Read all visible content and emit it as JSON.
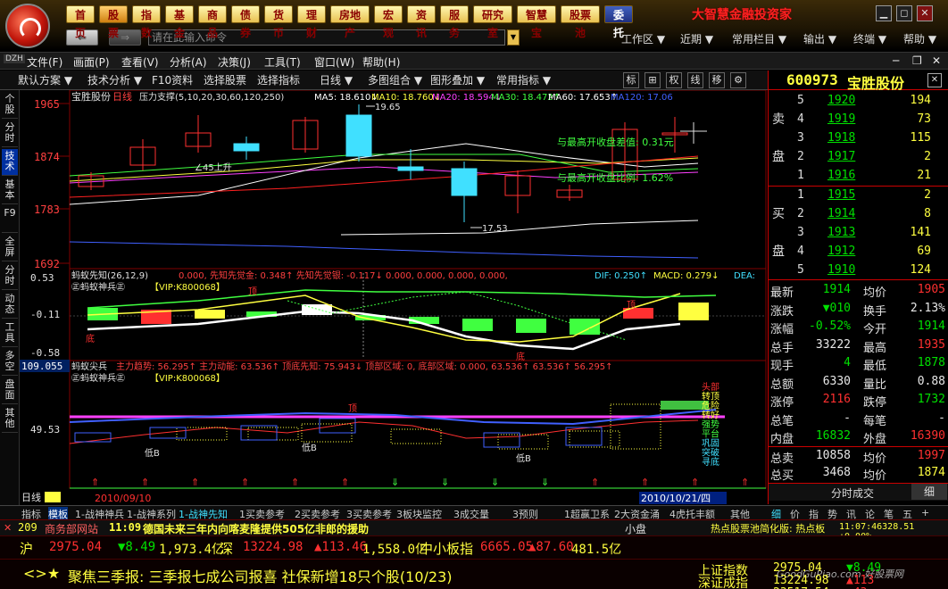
{
  "nav": {
    "items": [
      "首页",
      "股票",
      "指数",
      "基金",
      "商品",
      "债券",
      "货币",
      "理财",
      "房地产",
      "宏观",
      "资讯",
      "服务",
      "研究室",
      "智慧宝",
      "股票池",
      "委托"
    ],
    "selected": "股票",
    "brand": "大智慧金融投资家"
  },
  "command": {
    "placeholder": "请在此输入命令"
  },
  "top_menus": [
    "工作区 ▼",
    "近期 ▼",
    "常用栏目 ▼",
    "输出 ▼",
    "终端 ▼",
    "帮助 ▼"
  ],
  "menubar": [
    "文件(F)",
    "画面(P)",
    "查看(V)",
    "分析(A)",
    "决策(J)",
    "工具(T)",
    "窗口(W)",
    "帮助(H)"
  ],
  "toolbar": {
    "items": [
      "默认方案 ▼",
      "技术分析 ▼",
      "F10资料",
      "选择股票",
      "选择指标",
      "日线 ▼",
      "多图组合 ▼",
      "图形叠加 ▼",
      "常用指标 ▼"
    ],
    "right_buttons": [
      "标",
      "⊞",
      "权",
      "线",
      "移",
      "⚙"
    ]
  },
  "left_tabs": [
    "个股",
    "分时",
    "技术",
    "基本",
    "F9",
    "全屏",
    "分时",
    "动态",
    "工具",
    "多空",
    "盘面",
    "其他"
  ],
  "chart": {
    "main_title": "宝胜股份",
    "period": "日线",
    "indicator": "压力支撑(5,10,20,30,60,120,250)",
    "ma": [
      {
        "label": "MA5: 18.610↓",
        "color": "#ffffff"
      },
      {
        "label": "MA10: 18.760↓",
        "color": "#ffff40"
      },
      {
        "label": "MA20: 18.594↓",
        "color": "#ff40ff"
      },
      {
        "label": "MA30: 18.472↑",
        "color": "#40ff40"
      },
      {
        "label": "MA60: 17.653↑",
        "color": "#ffffff"
      },
      {
        "label": "MA120: 17.06",
        "color": "#4060ff"
      }
    ],
    "y_labels": [
      "1965",
      "1874",
      "1783",
      "1692"
    ],
    "annotations": [
      "19.65",
      "17.53",
      "∠45上升",
      "与最高开收盘差值: 0.31元",
      "与最高开收盘比例: 1.62%"
    ],
    "sub1": {
      "title": "蚂蚁先知(26,12,9)",
      "values": "0.000,  先知先觉金: 0.348↑  先知先觉银: -0.117↓  0.000, 0.000, 0.000, 0.000,",
      "dif": "DIF: 0.250↑",
      "macd": "MACD: 0.279↓",
      "dea": "DEA:",
      "badge": "㊣蚂蚁神兵㊣",
      "vip": "【VIP:K800068】",
      "y_labels": [
        "0.53",
        "-0.11",
        "-0.58"
      ],
      "marks": [
        "顶",
        "底",
        "顶",
        "底"
      ]
    },
    "sub2": {
      "title": "蚂蚁尖兵",
      "items": "主力趋势: 56.295↑  主力动能: 63.536↑  顶底先知: 75.943↓  顶部区域: 0,  底部区域: 0.000, 63.536↑  63.536↑  56.295↑",
      "badge": "㊣蚂蚁神兵㊣",
      "vip": "【VIP:K800068】",
      "y_labels": [
        "109.055",
        "49.53"
      ],
      "marks": [
        "顶",
        "低B",
        "低B",
        "低B",
        "头部",
        "转顶",
        "危险",
        "转好",
        "强势",
        "平台",
        "巩固",
        "突破",
        "寻底"
      ]
    },
    "period_label": "日线",
    "date_left": "2010/09/10",
    "date_right": "2010/10/21/四"
  },
  "quote": {
    "code": "600973",
    "name": "宝胜股份",
    "sell": [
      {
        "lvl": "5",
        "price": "1920",
        "vol": "194"
      },
      {
        "lvl": "4",
        "price": "1919",
        "vol": "73"
      },
      {
        "lvl": "3",
        "price": "1918",
        "vol": "115"
      },
      {
        "lvl": "2",
        "price": "1917",
        "vol": "2"
      },
      {
        "lvl": "1",
        "price": "1916",
        "vol": "21"
      }
    ],
    "buy": [
      {
        "lvl": "1",
        "price": "1915",
        "vol": "2"
      },
      {
        "lvl": "2",
        "price": "1914",
        "vol": "8"
      },
      {
        "lvl": "3",
        "price": "1913",
        "vol": "141"
      },
      {
        "lvl": "4",
        "price": "1912",
        "vol": "69"
      },
      {
        "lvl": "5",
        "price": "1910",
        "vol": "124"
      }
    ],
    "sell_label": [
      "卖",
      "盘"
    ],
    "buy_label": [
      "买",
      "盘"
    ],
    "stats": [
      {
        "l1": "最新",
        "v1": "1914",
        "l2": "均价",
        "v2": "1905",
        "c1": "grn",
        "c2": "red"
      },
      {
        "l1": "涨跌",
        "v1": "▼010",
        "l2": "换手",
        "v2": "2.13%",
        "c1": "grn",
        "c2": "wht"
      },
      {
        "l1": "涨幅",
        "v1": "-0.52%",
        "l2": "今开",
        "v2": "1914",
        "c1": "grn",
        "c2": "grn"
      },
      {
        "l1": "总手",
        "v1": "33222",
        "l2": "最高",
        "v2": "1935",
        "c1": "wht",
        "c2": "red"
      },
      {
        "l1": "现手",
        "v1": "4",
        "l2": "最低",
        "v2": "1878",
        "c1": "grn",
        "c2": "grn"
      },
      {
        "l1": "总额",
        "v1": "6330",
        "l2": "量比",
        "v2": "0.88",
        "c1": "wht",
        "c2": "wht"
      },
      {
        "l1": "涨停",
        "v1": "2116",
        "l2": "跌停",
        "v2": "1732",
        "c1": "red",
        "c2": "grn"
      },
      {
        "l1": "总笔",
        "v1": "-",
        "l2": "每笔",
        "v2": "-",
        "c1": "wht",
        "c2": "wht"
      },
      {
        "l1": "内盘",
        "v1": "16832",
        "l2": "外盘",
        "v2": "16390",
        "c1": "grn",
        "c2": "red"
      },
      {
        "l1": "总卖",
        "v1": "10858",
        "l2": "均价",
        "v2": "1997",
        "c1": "wht",
        "c2": "red"
      },
      {
        "l1": "总买",
        "v1": "3468",
        "l2": "均价",
        "v2": "1874",
        "c1": "wht",
        "c2": "yel"
      }
    ],
    "timeshare_btn": "分时成交",
    "small_btn": "细",
    "bottom_tabs": [
      "细",
      "价",
      "指",
      "势",
      "讯",
      "论",
      "笔",
      "五",
      "+"
    ]
  },
  "bottom_tabs": [
    "指标",
    "模板",
    "1-战神神兵",
    "1-战神系列",
    "1-战神先知",
    "1买卖参考",
    "2买卖参考",
    "3买卖参考",
    "3板块监控",
    "3成交量",
    "3预则",
    "1超赢卫系",
    "2大资金涌",
    "4虎托丰额",
    "其他"
  ],
  "ticker": {
    "count": "209",
    "site": "商务部网站",
    "time": "11:09",
    "headline": "德国未来三年内向喀麦隆提供505亿非郎的援助",
    "small": "小盘",
    "hot": "热点股票池简化版: 热点板",
    "status": "11:07:46328.51 +0.00%"
  },
  "indices": {
    "hu_label": "沪",
    "hu_val": "2975.04",
    "hu_chg": "▼8.49",
    "hu_amt": "1,973.4亿",
    "shen_label": "深",
    "shen_val": "13224.98",
    "shen_chg": "▲113.46",
    "shen_amt": "1,558.0亿",
    "zxb_label": "中小板指",
    "zxb_val": "6665.05",
    "zxb_chg": "▲87.60",
    "zxb_amt": "481.5亿"
  },
  "news": {
    "prefix": "<>★",
    "text": "聚焦三季报: 三季报七成公司报喜 社保新增18只个股(10/23)"
  },
  "index_panel": [
    {
      "name": "上证指数",
      "val": "2975.04",
      "chg": "▼8.49"
    },
    {
      "name": "深证成指",
      "val": "13224.98",
      "chg": "▲113"
    },
    {
      "name": "恒生指数",
      "val": "23517.54",
      "chg": "▲43"
    }
  ],
  "watermark": "GoodGuPiao.com 好股票网",
  "colors": {
    "up": "#ff3030",
    "down": "#00e000",
    "accent": "#ffff40",
    "brand": "#ff2020"
  }
}
